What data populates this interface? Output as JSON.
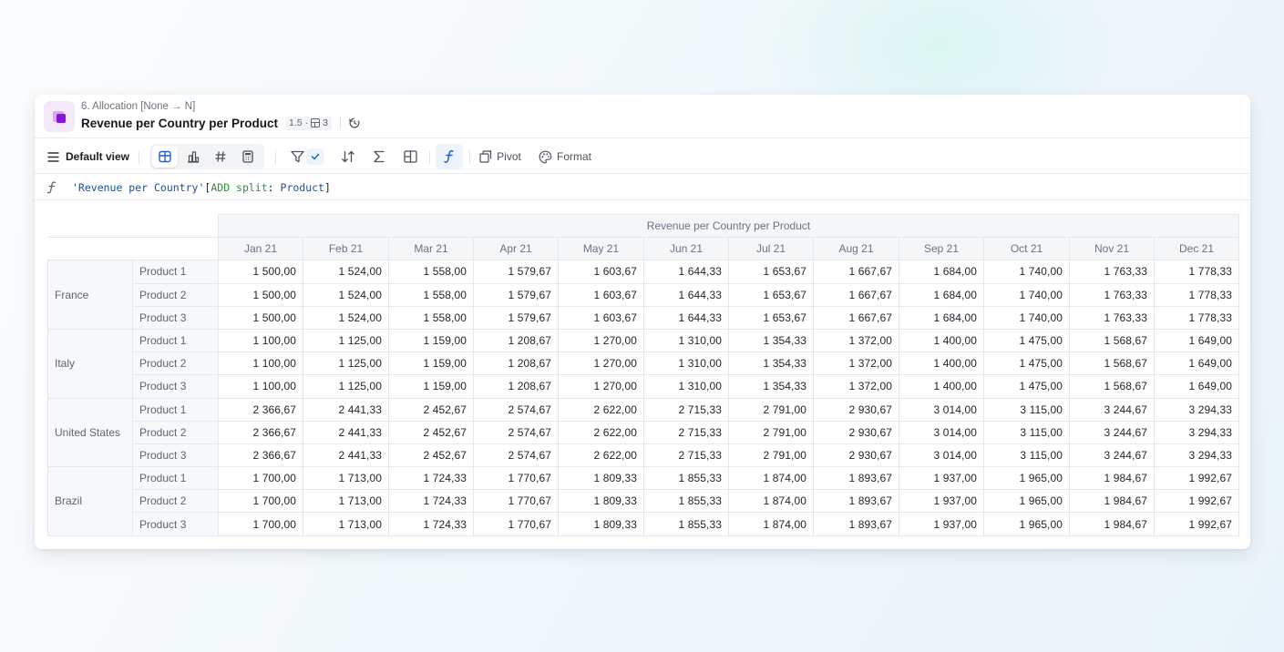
{
  "header": {
    "breadcrumb": "6. Allocation [None → N]",
    "title": "Revenue per Country per Product",
    "version": "1.5",
    "dimension_count": "3"
  },
  "toolbar": {
    "view_label": "Default view",
    "pivot_label": "Pivot",
    "format_label": "Format"
  },
  "formula": {
    "metric": "'Revenue per Country'",
    "open": "[",
    "keyword": "ADD split",
    "colon": ": ",
    "dimension": "Product",
    "close": "]"
  },
  "table": {
    "group_header": "Revenue per Country per Product",
    "months": [
      "Jan 21",
      "Feb 21",
      "Mar 21",
      "Apr 21",
      "May 21",
      "Jun 21",
      "Jul 21",
      "Aug 21",
      "Sep 21",
      "Oct 21",
      "Nov 21",
      "Dec 21"
    ],
    "groups": [
      {
        "country": "France",
        "rows": [
          {
            "product": "Product 1",
            "values": [
              "1 500,00",
              "1 524,00",
              "1 558,00",
              "1 579,67",
              "1 603,67",
              "1 644,33",
              "1 653,67",
              "1 667,67",
              "1 684,00",
              "1 740,00",
              "1 763,33",
              "1 778,33"
            ]
          },
          {
            "product": "Product 2",
            "values": [
              "1 500,00",
              "1 524,00",
              "1 558,00",
              "1 579,67",
              "1 603,67",
              "1 644,33",
              "1 653,67",
              "1 667,67",
              "1 684,00",
              "1 740,00",
              "1 763,33",
              "1 778,33"
            ]
          },
          {
            "product": "Product 3",
            "values": [
              "1 500,00",
              "1 524,00",
              "1 558,00",
              "1 579,67",
              "1 603,67",
              "1 644,33",
              "1 653,67",
              "1 667,67",
              "1 684,00",
              "1 740,00",
              "1 763,33",
              "1 778,33"
            ]
          }
        ]
      },
      {
        "country": "Italy",
        "rows": [
          {
            "product": "Product 1",
            "values": [
              "1 100,00",
              "1 125,00",
              "1 159,00",
              "1 208,67",
              "1 270,00",
              "1 310,00",
              "1 354,33",
              "1 372,00",
              "1 400,00",
              "1 475,00",
              "1 568,67",
              "1 649,00"
            ]
          },
          {
            "product": "Product 2",
            "values": [
              "1 100,00",
              "1 125,00",
              "1 159,00",
              "1 208,67",
              "1 270,00",
              "1 310,00",
              "1 354,33",
              "1 372,00",
              "1 400,00",
              "1 475,00",
              "1 568,67",
              "1 649,00"
            ]
          },
          {
            "product": "Product 3",
            "values": [
              "1 100,00",
              "1 125,00",
              "1 159,00",
              "1 208,67",
              "1 270,00",
              "1 310,00",
              "1 354,33",
              "1 372,00",
              "1 400,00",
              "1 475,00",
              "1 568,67",
              "1 649,00"
            ]
          }
        ]
      },
      {
        "country": "United States",
        "rows": [
          {
            "product": "Product 1",
            "values": [
              "2 366,67",
              "2 441,33",
              "2 452,67",
              "2 574,67",
              "2 622,00",
              "2 715,33",
              "2 791,00",
              "2 930,67",
              "3 014,00",
              "3 115,00",
              "3 244,67",
              "3 294,33"
            ]
          },
          {
            "product": "Product 2",
            "values": [
              "2 366,67",
              "2 441,33",
              "2 452,67",
              "2 574,67",
              "2 622,00",
              "2 715,33",
              "2 791,00",
              "2 930,67",
              "3 014,00",
              "3 115,00",
              "3 244,67",
              "3 294,33"
            ]
          },
          {
            "product": "Product 3",
            "values": [
              "2 366,67",
              "2 441,33",
              "2 452,67",
              "2 574,67",
              "2 622,00",
              "2 715,33",
              "2 791,00",
              "2 930,67",
              "3 014,00",
              "3 115,00",
              "3 244,67",
              "3 294,33"
            ]
          }
        ]
      },
      {
        "country": "Brazil",
        "rows": [
          {
            "product": "Product 1",
            "values": [
              "1 700,00",
              "1 713,00",
              "1 724,33",
              "1 770,67",
              "1 809,33",
              "1 855,33",
              "1 874,00",
              "1 893,67",
              "1 937,00",
              "1 965,00",
              "1 984,67",
              "1 992,67"
            ]
          },
          {
            "product": "Product 2",
            "values": [
              "1 700,00",
              "1 713,00",
              "1 724,33",
              "1 770,67",
              "1 809,33",
              "1 855,33",
              "1 874,00",
              "1 893,67",
              "1 937,00",
              "1 965,00",
              "1 984,67",
              "1 992,67"
            ]
          },
          {
            "product": "Product 3",
            "values": [
              "1 700,00",
              "1 713,00",
              "1 724,33",
              "1 770,67",
              "1 809,33",
              "1 855,33",
              "1 874,00",
              "1 893,67",
              "1 937,00",
              "1 965,00",
              "1 984,67",
              "1 992,67"
            ]
          }
        ]
      }
    ]
  },
  "icons": {
    "app": "allocation-block-icon",
    "menu": "hamburger-menu-icon",
    "table_view": "table-grid-icon",
    "chart_view": "bar-chart-icon",
    "number_view": "hash-icon",
    "calc_view": "calculator-icon",
    "filter": "filter-icon",
    "sort": "sort-icon",
    "sum": "sigma-icon",
    "layout": "layout-columns-icon",
    "formula": "function-icon",
    "pivot": "pivot-icon",
    "format": "palette-icon",
    "history": "history-icon"
  },
  "colors": {
    "accent": "#1d63c9",
    "app_icon": "#8b12d8",
    "header_bg": "#f5f6f8"
  }
}
